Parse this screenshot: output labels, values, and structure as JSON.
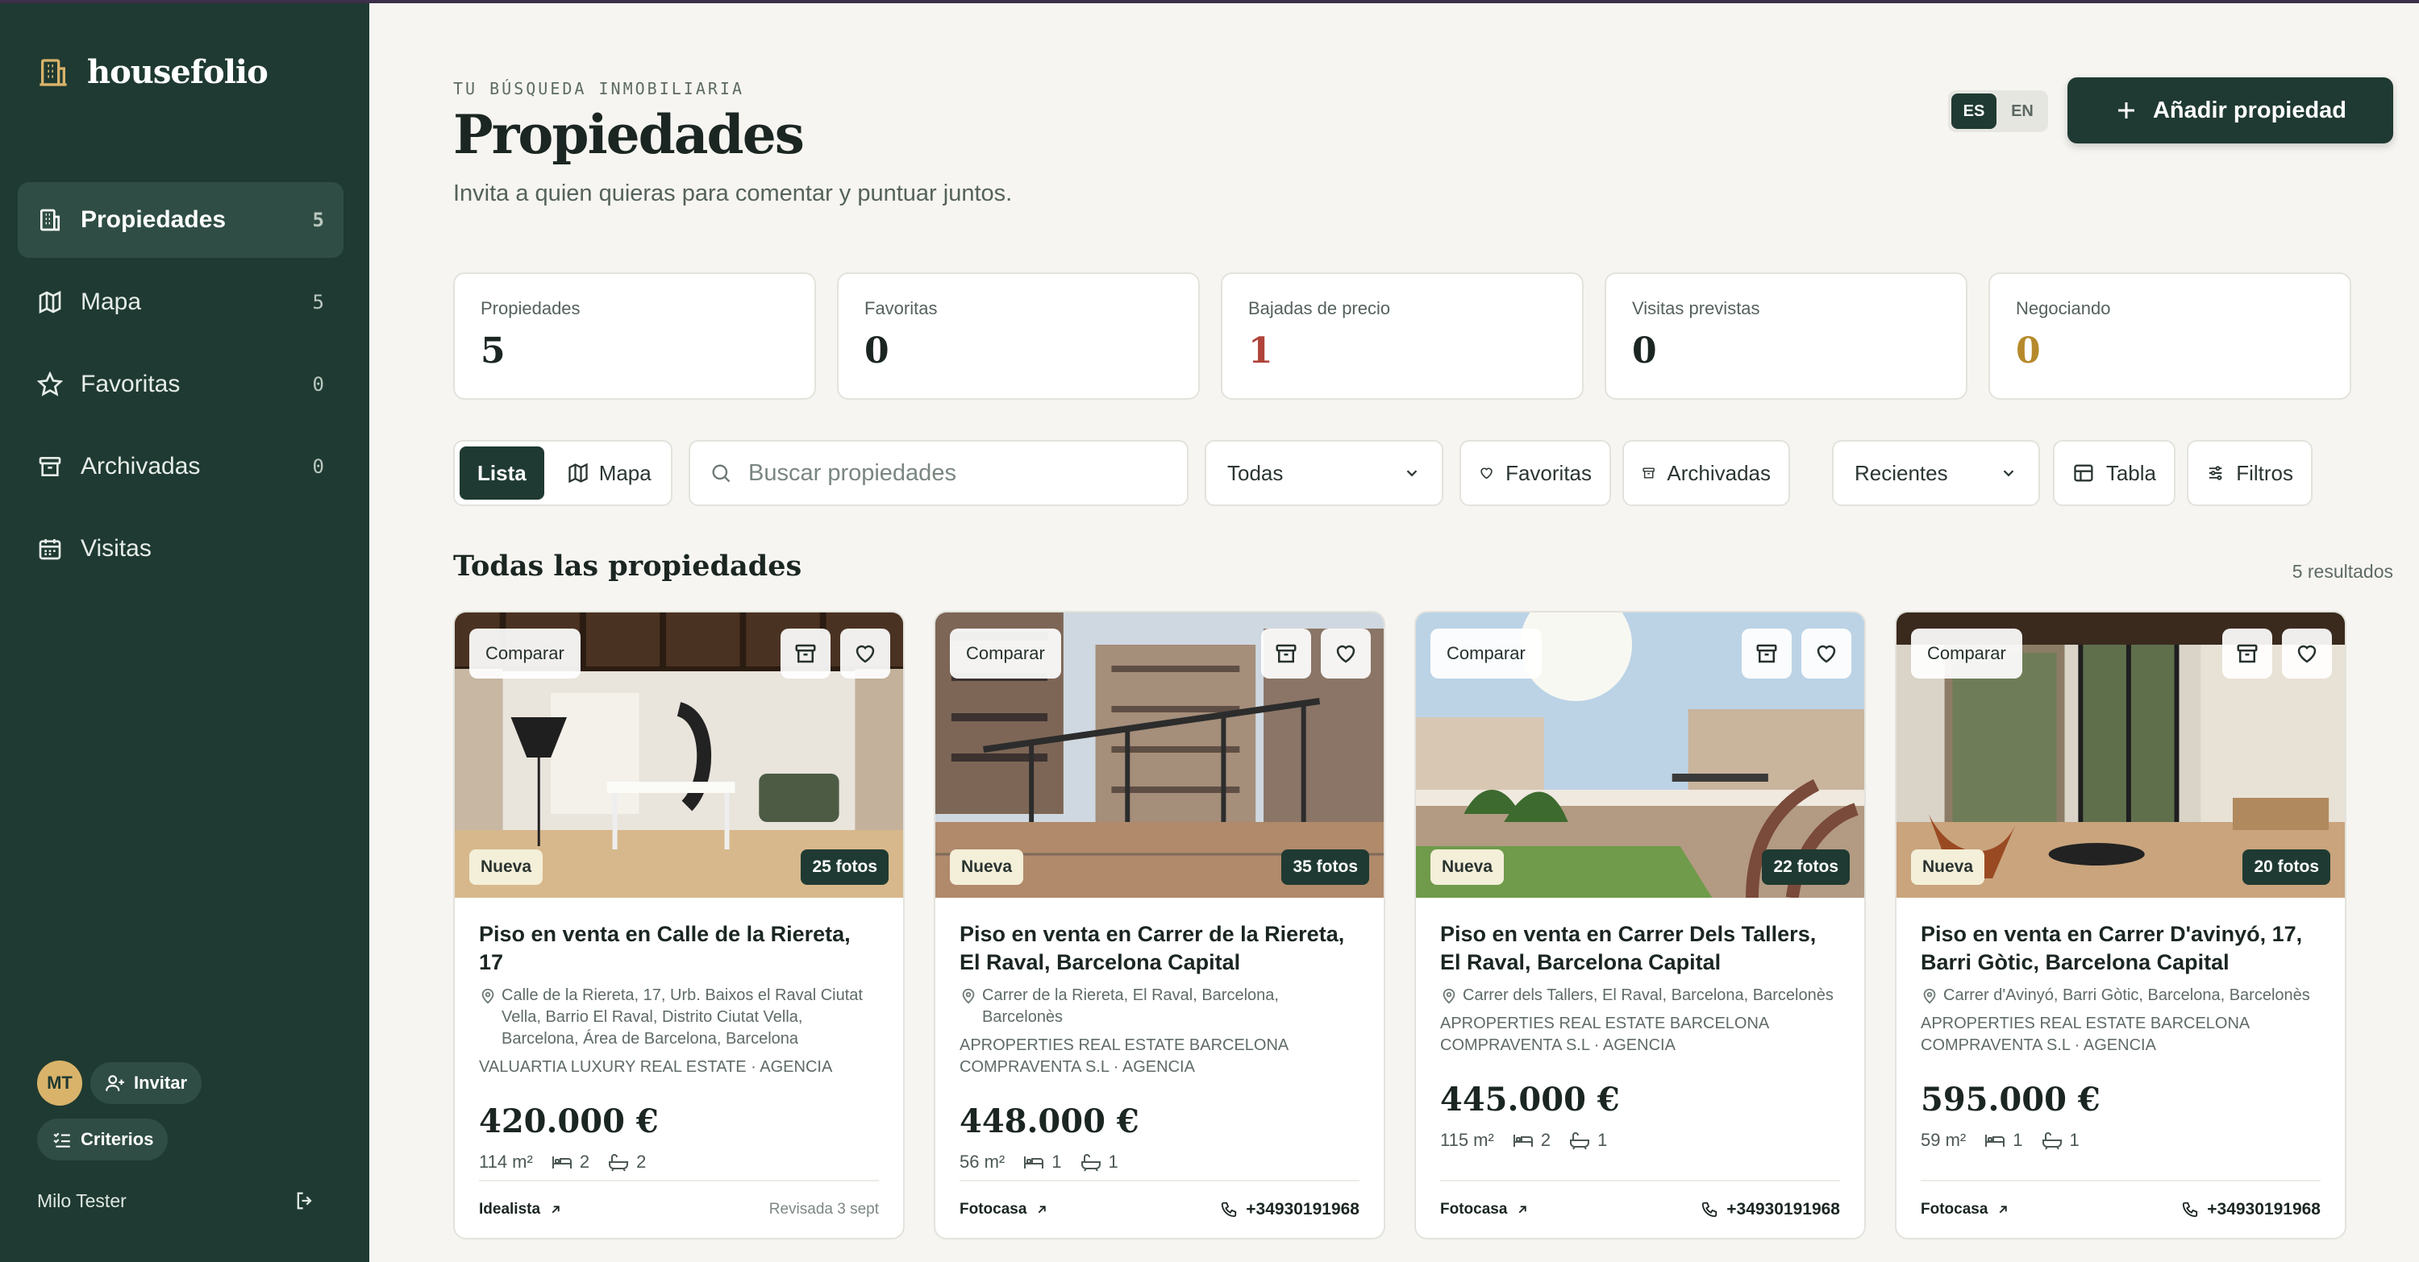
{
  "app": {
    "name": "housefolio"
  },
  "sidebar": {
    "items": [
      {
        "label": "Propiedades",
        "count": "5",
        "icon": "building-icon",
        "active": true
      },
      {
        "label": "Mapa",
        "count": "5",
        "icon": "map-icon"
      },
      {
        "label": "Favoritas",
        "count": "0",
        "icon": "star-icon"
      },
      {
        "label": "Archivadas",
        "count": "0",
        "icon": "archive-icon"
      },
      {
        "label": "Visitas",
        "count": "",
        "icon": "calendar-icon"
      }
    ],
    "avatar_initials": "MT",
    "invite_label": "Invitar",
    "criteria_label": "Criterios",
    "user_name": "Milo Tester"
  },
  "header": {
    "eyebrow": "TU BÚSQUEDA INMOBILIARIA",
    "title": "Propiedades",
    "subtitle": "Invita a quien quieras para comentar y puntuar juntos.",
    "lang_es": "ES",
    "lang_en": "EN",
    "add_label": "Añadir propiedad"
  },
  "stats": [
    {
      "label": "Propiedades",
      "value": "5",
      "color": "#1b2622"
    },
    {
      "label": "Favoritas",
      "value": "0",
      "color": "#1b2622"
    },
    {
      "label": "Bajadas de precio",
      "value": "1",
      "color": "#b0443a"
    },
    {
      "label": "Visitas previstas",
      "value": "0",
      "color": "#1b2622"
    },
    {
      "label": "Negociando",
      "value": "0",
      "color": "#b68a2c"
    }
  ],
  "toolbar": {
    "view_list": "Lista",
    "view_map": "Mapa",
    "search_placeholder": "Buscar propiedades",
    "status_select": "Todas",
    "favorites": "Favoritas",
    "archived": "Archivadas",
    "sort_select": "Recientes",
    "table": "Tabla",
    "filters": "Filtros"
  },
  "section": {
    "title": "Todas las propiedades",
    "results": "5 resultados"
  },
  "cards": [
    {
      "compare": "Comparar",
      "badge": "Nueva",
      "photos": "25 fotos",
      "title": "Piso en venta en Calle de la Riereta, 17",
      "address": "Calle de la Riereta, 17, Urb. Baixos el Raval Ciutat Vella, Barrio El Raval, Distrito Ciutat Vella, Barcelona, Área de Barcelona, Barcelona",
      "agency": "VALUARTIA LUXURY REAL ESTATE · Agencia",
      "price": "420.000 €",
      "area": "114 m²",
      "beds": "2",
      "baths": "2",
      "source": "Idealista",
      "reviewed": "Revisada 3 sept",
      "phone": ""
    },
    {
      "compare": "Comparar",
      "badge": "Nueva",
      "photos": "35 fotos",
      "title": "Piso en venta en Carrer de la Riereta, El Raval, Barcelona Capital",
      "address": "Carrer de la Riereta, El Raval, Barcelona, Barcelonès",
      "agency": "APROPERTIES REAL ESTATE BARCELONA COMPRAVENTA S.L · Agencia",
      "price": "448.000 €",
      "area": "56 m²",
      "beds": "1",
      "baths": "1",
      "source": "Fotocasa",
      "reviewed": "",
      "phone": "+34930191968"
    },
    {
      "compare": "Comparar",
      "badge": "Nueva",
      "photos": "22 fotos",
      "title": "Piso en venta en Carrer Dels Tallers, El Raval, Barcelona Capital",
      "address": "Carrer dels Tallers, El Raval, Barcelona, Barcelonès",
      "agency": "APROPERTIES REAL ESTATE BARCELONA COMPRAVENTA S.L · Agencia",
      "price": "445.000 €",
      "area": "115 m²",
      "beds": "2",
      "baths": "1",
      "source": "Fotocasa",
      "reviewed": "",
      "phone": "+34930191968"
    },
    {
      "compare": "Comparar",
      "badge": "Nueva",
      "photos": "20 fotos",
      "title": "Piso en venta en Carrer D'avinyó, 17, Barri Gòtic, Barcelona Capital",
      "address": "Carrer d'Avinyó, Barri Gòtic, Barcelona, Barcelonès",
      "agency": "APROPERTIES REAL ESTATE BARCELONA COMPRAVENTA S.L · Agencia",
      "price": "595.000 €",
      "area": "59 m²",
      "beds": "1",
      "baths": "1",
      "source": "Fotocasa",
      "reviewed": "",
      "phone": "+34930191968"
    }
  ]
}
